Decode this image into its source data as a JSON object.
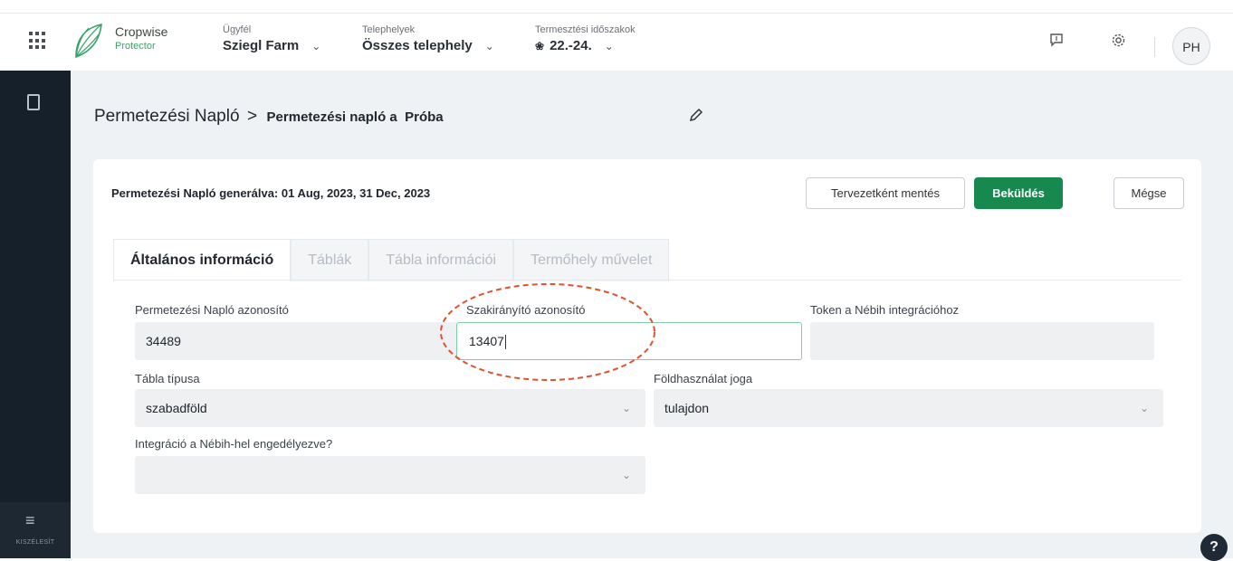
{
  "header": {
    "logo": {
      "name": "Cropwise",
      "subname": "Protector"
    },
    "client": {
      "label": "Ügyfél",
      "value": "Sziegl Farm"
    },
    "sites": {
      "label": "Telephelyek",
      "value": "Összes telephely"
    },
    "season": {
      "label": "Termesztési időszakok",
      "value": "22.-24."
    },
    "avatar_initials": "PH",
    "icons": [
      "apps-grid-icon",
      "feedback-icon",
      "settings-icon"
    ]
  },
  "sidebar": {
    "bottom_label": "KISZÉLESÍT"
  },
  "breadcrumb": {
    "root": "Permetezési Napló",
    "separator": ">",
    "current": "Permetezési napló a  Próba"
  },
  "card": {
    "generated_text": "Permetezési Napló generálva: 01 Aug, 2023, 31 Dec, 2023",
    "buttons": {
      "draft": "Tervezetként mentés",
      "submit": "Beküldés",
      "cancel": "Mégse"
    },
    "tabs": [
      "Általános információ",
      "Táblák",
      "Tábla információi",
      "Termőhely művelet"
    ],
    "active_tab": 0,
    "fields": {
      "log_id": {
        "label": "Permetezési Napló azonosító",
        "value": "34489"
      },
      "advisor_id": {
        "label": "Szakirányító azonosító",
        "value": "13407"
      },
      "token": {
        "label": "Token a Nébih integrációhoz",
        "value": ""
      },
      "field_type": {
        "label": "Tábla típusa",
        "value": "szabadföld"
      },
      "land_use": {
        "label": "Földhasználat joga",
        "value": "tulajdon"
      },
      "integration": {
        "label": "Integráció a Nébih-hel engedélyezve?",
        "value": ""
      }
    }
  },
  "colors": {
    "accent_green": "#17894f",
    "sidebar_bg": "#16202a",
    "annotation_red": "#e0522f"
  }
}
